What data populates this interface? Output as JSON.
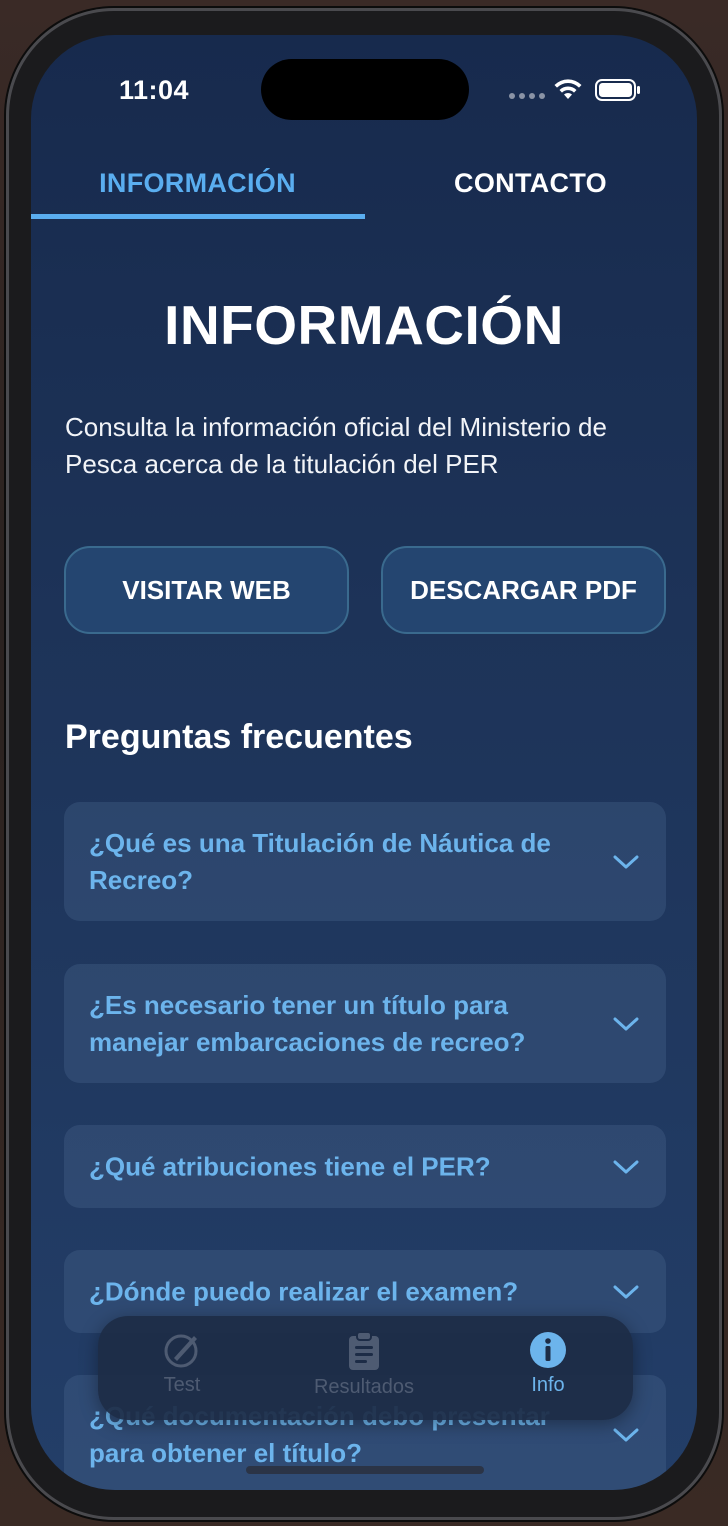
{
  "status_bar": {
    "time": "11:04"
  },
  "top_tabs": [
    {
      "label": "INFORMACIÓN",
      "active": true
    },
    {
      "label": "CONTACTO",
      "active": false
    }
  ],
  "page": {
    "title": "INFORMACIÓN",
    "intro": "Consulta la información oficial del Ministerio de Pesca acerca de la titulación del PER"
  },
  "actions": {
    "visit_web": "VISITAR WEB",
    "download_pdf": "DESCARGAR PDF"
  },
  "faq": {
    "heading": "Preguntas frecuentes",
    "items": [
      {
        "question": "¿Qué es una Titulación de Náutica de Recreo?"
      },
      {
        "question": "¿Es necesario tener un título para manejar embarcaciones de recreo?"
      },
      {
        "question": "¿Qué atribuciones tiene el PER?"
      },
      {
        "question": "¿Dónde puedo realizar el examen?"
      },
      {
        "question": "¿Qué documentación debo presentar para obtener el título?"
      }
    ]
  },
  "tab_bar": {
    "items": [
      {
        "label": "Test",
        "icon": "pencil-circle-icon",
        "active": false
      },
      {
        "label": "Resultados",
        "icon": "clipboard-icon",
        "active": false
      },
      {
        "label": "Info",
        "icon": "info-circle-icon",
        "active": true
      }
    ]
  },
  "colors": {
    "accent": "#5aaef0",
    "background_top": "#172a4d",
    "background_bottom": "#233e68",
    "button_fill": "#244570"
  }
}
